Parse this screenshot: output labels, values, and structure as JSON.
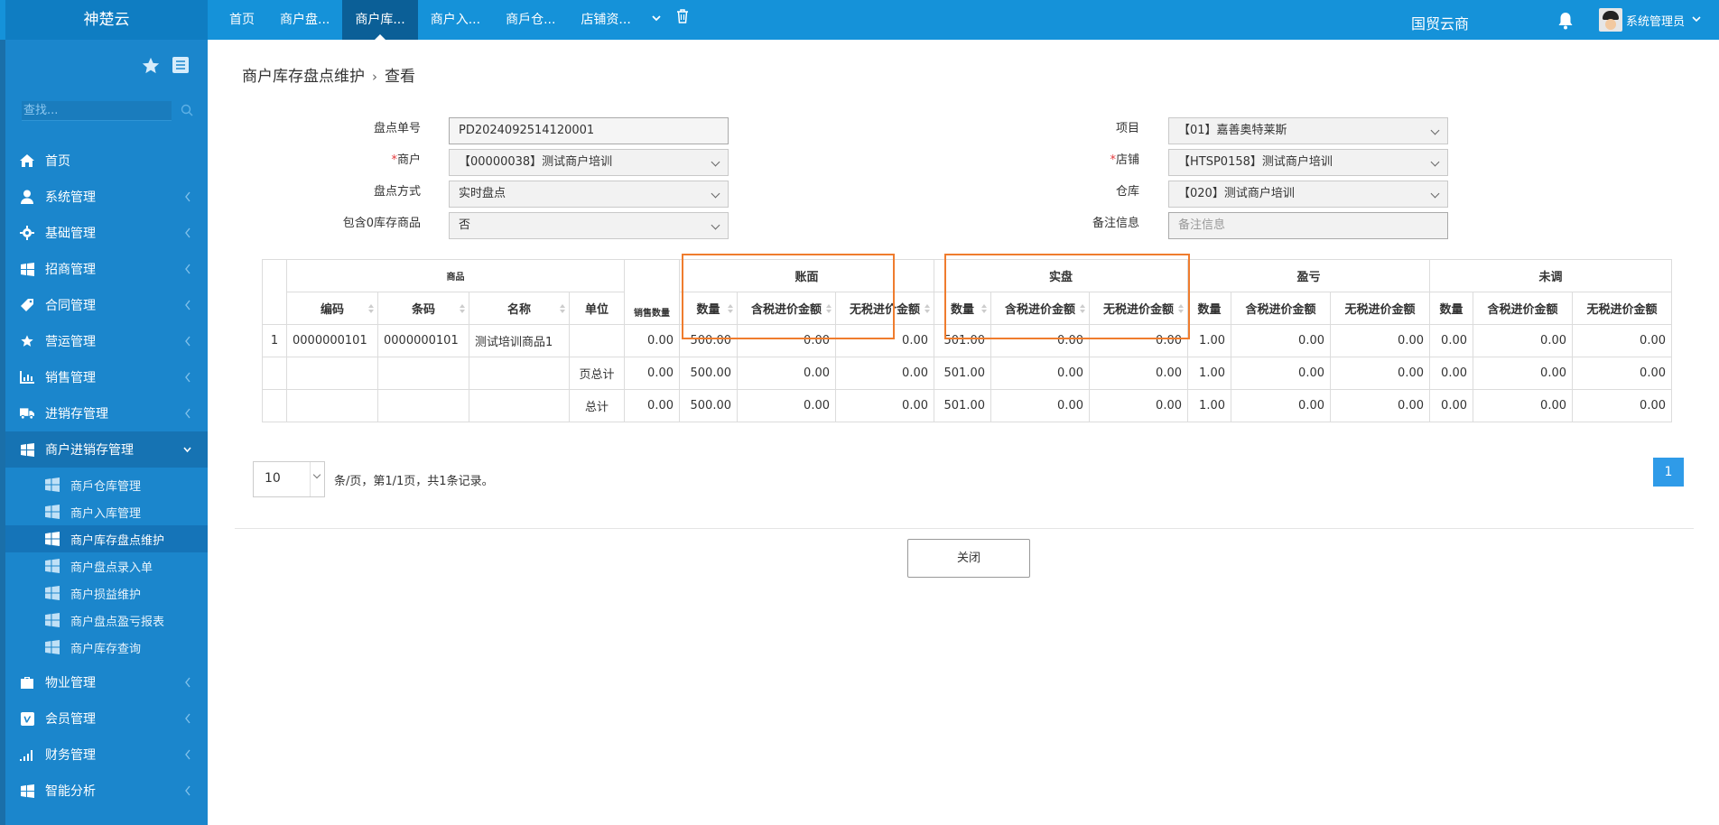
{
  "topbar": {
    "brand": "神楚云",
    "tabs": [
      {
        "label": "首页",
        "active": false
      },
      {
        "label": "商户盘...",
        "active": false
      },
      {
        "label": "商户库...",
        "active": true
      },
      {
        "label": "商户入...",
        "active": false
      },
      {
        "label": "商戶仓...",
        "active": false
      },
      {
        "label": "店铺资...",
        "active": false
      }
    ],
    "org": "国贸云商",
    "user": "系统管理员"
  },
  "sidebar": {
    "search_placeholder": "查找...",
    "menu": [
      {
        "label": "首页",
        "icon": "home-icon"
      },
      {
        "label": "系统管理",
        "icon": "user-icon"
      },
      {
        "label": "基础管理",
        "icon": "gear-icon"
      },
      {
        "label": "招商管理",
        "icon": "windows-icon"
      },
      {
        "label": "合同管理",
        "icon": "tag-icon"
      },
      {
        "label": "营运管理",
        "icon": "star-icon"
      },
      {
        "label": "销售管理",
        "icon": "bar-chart-icon"
      },
      {
        "label": "进销存管理",
        "icon": "truck-icon"
      },
      {
        "label": "商户进销存管理",
        "icon": "windows-icon",
        "open": true
      }
    ],
    "submenu": [
      {
        "label": "商戶仓库管理",
        "active": false
      },
      {
        "label": "商户入库管理",
        "active": false
      },
      {
        "label": "商户库存盘点维护",
        "active": true
      },
      {
        "label": "商户盘点录入单",
        "active": false
      },
      {
        "label": "商户损益维护",
        "active": false
      },
      {
        "label": "商户盘点盈亏报表",
        "active": false
      },
      {
        "label": "商户库存查询",
        "active": false
      }
    ],
    "menu_after": [
      {
        "label": "物业管理",
        "icon": "briefcase-icon"
      },
      {
        "label": "会员管理",
        "icon": "vimeo-icon"
      },
      {
        "label": "财务管理",
        "icon": "signal-icon"
      },
      {
        "label": "智能分析",
        "icon": "windows-icon"
      }
    ]
  },
  "breadcrumb": {
    "parent": "商户库存盘点维护",
    "current": "查看"
  },
  "form": {
    "order_no_label": "盘点单号",
    "order_no": "PD2024092514120001",
    "merchant_label": "商户",
    "merchant": "【00000038】测试商户培训",
    "method_label": "盘点方式",
    "method": "实时盘点",
    "zero_label": "包含0库存商品",
    "zero": "否",
    "project_label": "项目",
    "project": "【01】嘉善奥特莱斯",
    "store_label": "店铺",
    "store": "【HTSP0158】测试商户培训",
    "warehouse_label": "仓库",
    "warehouse": "【020】测试商户培训",
    "remark_label": "备注信息",
    "remark_placeholder": "备注信息"
  },
  "table": {
    "group_goods": "商品",
    "group_book": "账面",
    "group_actual": "实盘",
    "group_diff": "盈亏",
    "group_unadj": "未调",
    "col_code": "编码",
    "col_barcode": "条码",
    "col_name": "名称",
    "col_unit": "单位",
    "col_sales": "销售数量",
    "col_qty": "数量",
    "col_tax_amt": "含税进价金额",
    "col_notax_amt": "无税进价金额",
    "rows": [
      {
        "idx": "1",
        "code": "0000000101",
        "barcode": "0000000101",
        "name": "测试培训商品1",
        "unit": "",
        "sales": "0.00",
        "b_qty": "500.00",
        "b_tax": "0.00",
        "b_notax": "0.00",
        "a_qty": "501.00",
        "a_tax": "0.00",
        "a_notax": "0.00",
        "d_qty": "1.00",
        "d_tax": "0.00",
        "d_notax": "0.00",
        "u_qty": "0.00",
        "u_tax": "0.00",
        "u_notax": "0.00"
      },
      {
        "idx": "",
        "code": "",
        "barcode": "",
        "name": "",
        "unit": "页总计",
        "sales": "0.00",
        "b_qty": "500.00",
        "b_tax": "0.00",
        "b_notax": "0.00",
        "a_qty": "501.00",
        "a_tax": "0.00",
        "a_notax": "0.00",
        "d_qty": "1.00",
        "d_tax": "0.00",
        "d_notax": "0.00",
        "u_qty": "0.00",
        "u_tax": "0.00",
        "u_notax": "0.00"
      },
      {
        "idx": "",
        "code": "",
        "barcode": "",
        "name": "",
        "unit": "总计",
        "sales": "0.00",
        "b_qty": "500.00",
        "b_tax": "0.00",
        "b_notax": "0.00",
        "a_qty": "501.00",
        "a_tax": "0.00",
        "a_notax": "0.00",
        "d_qty": "1.00",
        "d_tax": "0.00",
        "d_notax": "0.00",
        "u_qty": "0.00",
        "u_tax": "0.00",
        "u_notax": "0.00"
      }
    ]
  },
  "pager": {
    "page_size": "10",
    "info": "条/页，第1/1页，共1条记录。",
    "current_page": "1"
  },
  "buttons": {
    "close": "关闭"
  },
  "colors": {
    "topbar": "#1592d9",
    "sidebar": "#1b86cc",
    "highlight": "#ef7c2e",
    "pager_active": "#2f9be8"
  }
}
